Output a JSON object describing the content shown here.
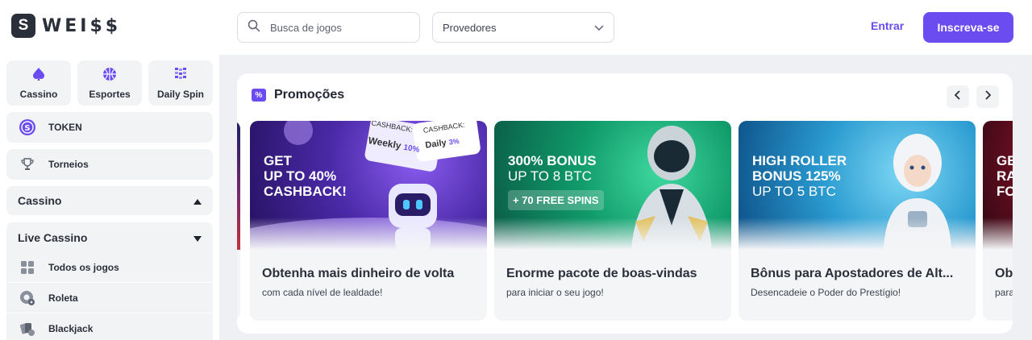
{
  "header": {
    "logo_letter": "S",
    "logo_text": "WEI$$",
    "search_placeholder": "Busca de jogos",
    "providers_label": "Provedores",
    "login_label": "Entrar",
    "signup_label": "Inscreva-se"
  },
  "sidebar": {
    "tiles": [
      {
        "label": "Cassino",
        "icon": "spade-icon"
      },
      {
        "label": "Esportes",
        "icon": "basketball-icon"
      },
      {
        "label": "Daily Spin",
        "icon": "slot-reel-icon"
      }
    ],
    "token_label": "TOKEN",
    "tournaments_label": "Torneios",
    "casino_section": "Cassino",
    "live_section": "Live Cassino",
    "live_items": [
      {
        "label": "Todos os jogos",
        "icon": "grid-icon"
      },
      {
        "label": "Roleta",
        "icon": "roulette-icon"
      },
      {
        "label": "Blackjack",
        "icon": "cards-icon"
      }
    ]
  },
  "promotions": {
    "title": "Promoções",
    "cards": [
      {
        "headline_1": "GET",
        "headline_2": "UP TO 40%",
        "headline_3": "CASHBACK!",
        "ticket_1_top": "CASHBACK:",
        "ticket_1_main": "Weekly",
        "ticket_1_pct": "10%",
        "ticket_2_top": "CASHBACK:",
        "ticket_2_main": "Daily",
        "ticket_2_pct": "3%",
        "title": "Obtenha mais dinheiro de volta",
        "subtitle": "com cada nível de lealdade!"
      },
      {
        "headline_1": "300% BONUS",
        "headline_2": "UP TO 8 BTC",
        "badge": "+ 70 FREE SPINS",
        "title": "Enorme pacote de boas-vindas",
        "subtitle": "para iniciar o seu jogo!"
      },
      {
        "headline_1": "HIGH ROLLER",
        "headline_2": "BONUS 125%",
        "headline_3": "UP TO 5 BTC",
        "title": "Bônus para Apostadores de Alt...",
        "subtitle": "Desencadeie o Poder do Prestígio!"
      },
      {
        "headline_1": "GE",
        "headline_2": "RA",
        "headline_3": "FO",
        "title": "Ob",
        "subtitle": "para"
      }
    ]
  },
  "colors": {
    "accent": "#6a4cf0",
    "dark": "#2a2f3a",
    "panel_bg": "#eef0f3"
  }
}
